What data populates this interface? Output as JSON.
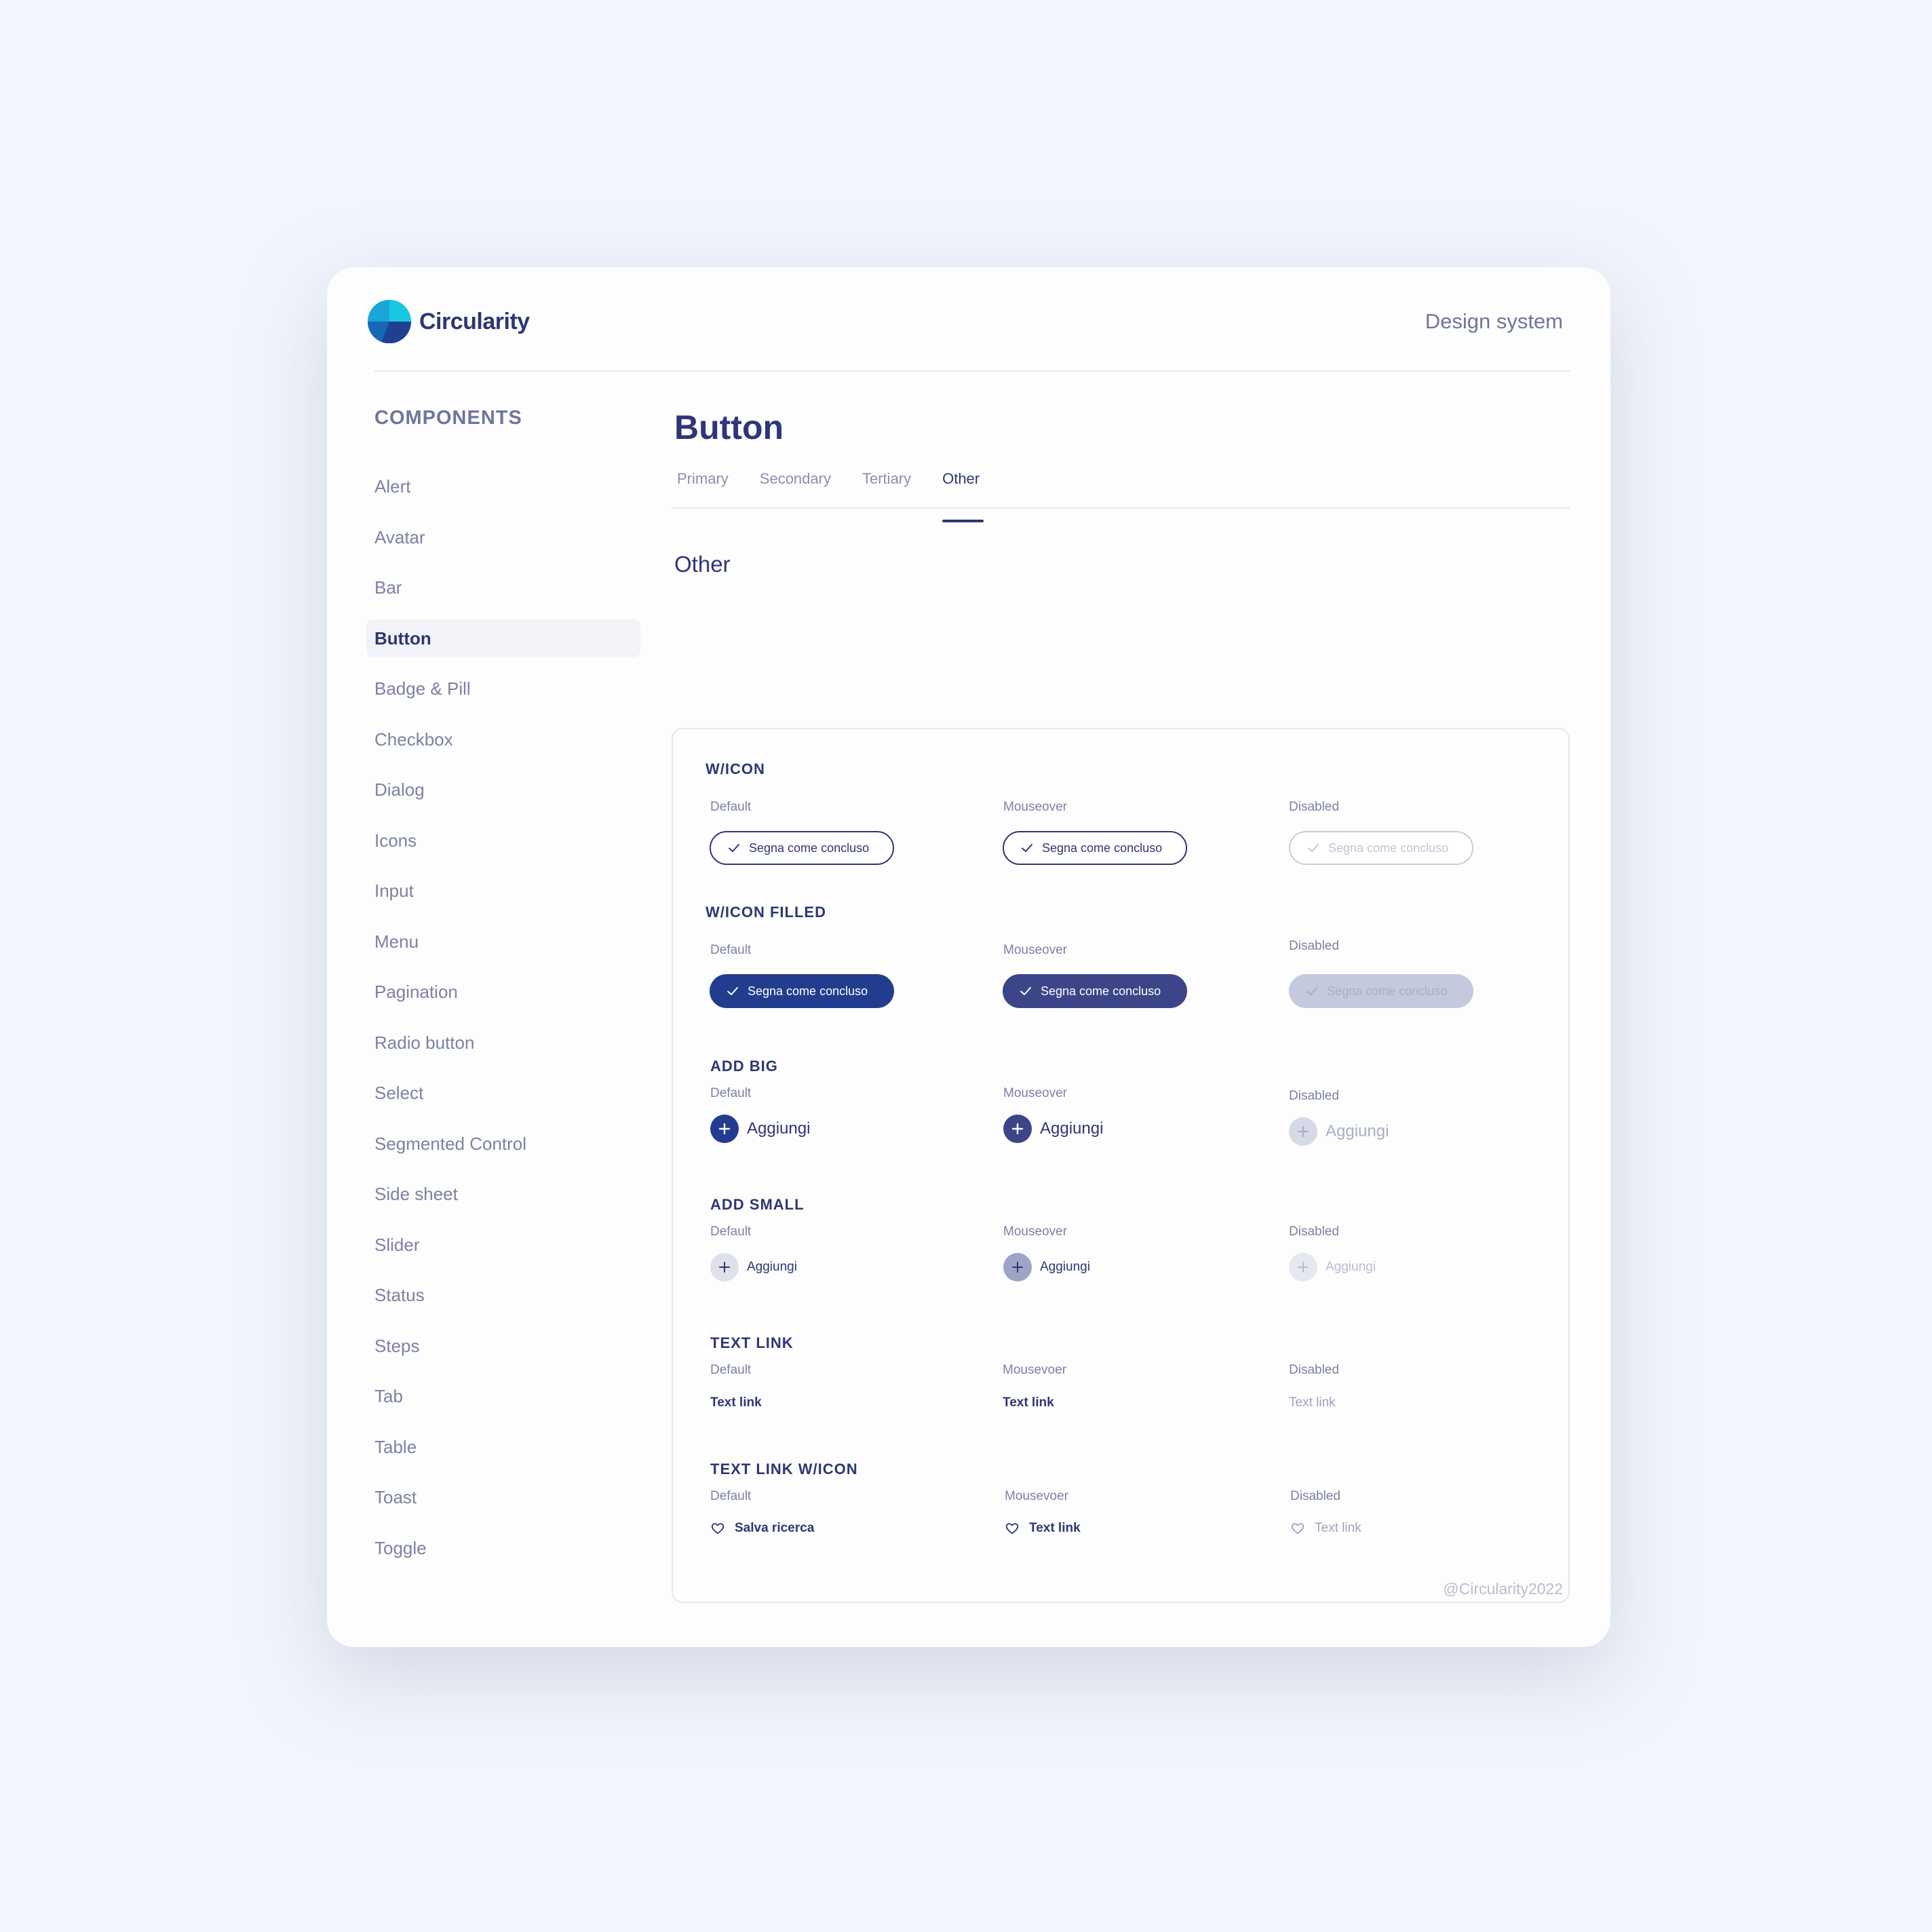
{
  "header": {
    "brand": "Circularity",
    "right_label": "Design system"
  },
  "sidebar": {
    "title": "COMPONENTS",
    "items": [
      {
        "label": "Alert"
      },
      {
        "label": "Avatar"
      },
      {
        "label": "Bar"
      },
      {
        "label": "Button",
        "active": true
      },
      {
        "label": "Badge & Pill"
      },
      {
        "label": "Checkbox"
      },
      {
        "label": "Dialog"
      },
      {
        "label": "Icons"
      },
      {
        "label": "Input"
      },
      {
        "label": "Menu"
      },
      {
        "label": "Pagination"
      },
      {
        "label": "Radio button"
      },
      {
        "label": "Select"
      },
      {
        "label": "Segmented Control"
      },
      {
        "label": "Side sheet"
      },
      {
        "label": "Slider"
      },
      {
        "label": "Status"
      },
      {
        "label": "Steps"
      },
      {
        "label": "Tab"
      },
      {
        "label": "Table"
      },
      {
        "label": "Toast"
      },
      {
        "label": "Toggle"
      }
    ]
  },
  "main": {
    "title": "Button",
    "tabs": [
      {
        "label": "Primary"
      },
      {
        "label": "Secondary"
      },
      {
        "label": "Tertiary"
      },
      {
        "label": "Other",
        "active": true
      }
    ],
    "section_title": "Other",
    "groups": {
      "w_icon": {
        "title": "W/ICON",
        "states": [
          "Default",
          "Mouseover",
          "Disabled"
        ],
        "button_label": "Segna come concluso"
      },
      "w_icon_filled": {
        "title": "W/ICON FILLED",
        "states": [
          "Default",
          "Mouseover",
          "Disabled"
        ],
        "button_label": "Segna come concluso"
      },
      "add_big": {
        "title": "ADD BIG",
        "states": [
          "Default",
          "Mouseover",
          "Disabled"
        ],
        "button_label": "Aggiungi"
      },
      "add_small": {
        "title": "ADD SMALL",
        "states": [
          "Default",
          "Mouseover",
          "Disabled"
        ],
        "button_label": "Aggiungi"
      },
      "text_link": {
        "title": "TEXT LINK",
        "states": [
          "Default",
          "Mousevoer",
          "Disabled"
        ],
        "labels": [
          "Text link",
          "Text link",
          "Text link"
        ]
      },
      "text_link_icon": {
        "title": "TEXT LINK W/ICON",
        "states": [
          "Default",
          "Mousevoer",
          "Disabled"
        ],
        "labels": [
          "Salva ricerca",
          "Text link",
          "Text link"
        ]
      }
    }
  },
  "footer": "@Circularity2022",
  "colors": {
    "primary": "#223d8e",
    "text_dark": "#2e3675",
    "muted": "#7c81a4",
    "disabled": "#c4c9de"
  }
}
